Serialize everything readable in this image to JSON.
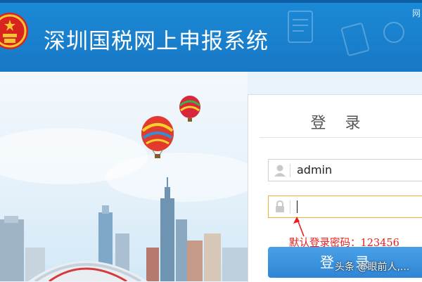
{
  "header": {
    "title": "深圳国税网上申报系统",
    "corner_text": "网"
  },
  "login": {
    "title": "登 录",
    "username_value": "admin",
    "password_value": "",
    "hint": "默认登录密码：123456",
    "button_label": "登 录"
  },
  "watermark": "头条 @眼前人,...",
  "icons": [
    "national-emblem-icon",
    "user-icon",
    "lock-icon"
  ],
  "colors": {
    "header_blue": "#1b8ad6",
    "button_blue": "#3a8fdc",
    "hint_red": "#e81d1d",
    "focus_border": "#f0b040"
  }
}
